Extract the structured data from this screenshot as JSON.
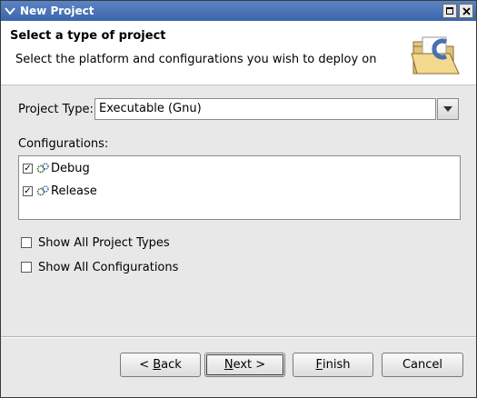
{
  "window": {
    "title": "New Project"
  },
  "header": {
    "title": "Select a type of project",
    "description": "Select the platform and configurations you wish to deploy on",
    "icon": "folder-c-icon"
  },
  "project_type": {
    "label": "Project Type:",
    "value": "Executable (Gnu)"
  },
  "configurations": {
    "label": "Configurations:",
    "items": [
      {
        "label": "Debug",
        "checked": true,
        "icon": "config-gears-icon"
      },
      {
        "label": "Release",
        "checked": true,
        "icon": "config-gears-icon"
      }
    ]
  },
  "options": {
    "show_all_project_types": {
      "label": "Show All Project Types",
      "checked": false
    },
    "show_all_configurations": {
      "label": "Show All Configurations",
      "checked": false
    }
  },
  "buttons": {
    "back": {
      "prefix": "< ",
      "mnemonic": "B",
      "rest": "ack"
    },
    "next": {
      "mnemonic": "N",
      "rest": "ext >"
    },
    "finish": {
      "mnemonic": "F",
      "rest": "inish"
    },
    "cancel": {
      "label": "Cancel"
    }
  },
  "colors": {
    "titlebar": "#3c66ab",
    "header_bg": "#ffffff",
    "dialog_bg": "#e8e8e8"
  }
}
